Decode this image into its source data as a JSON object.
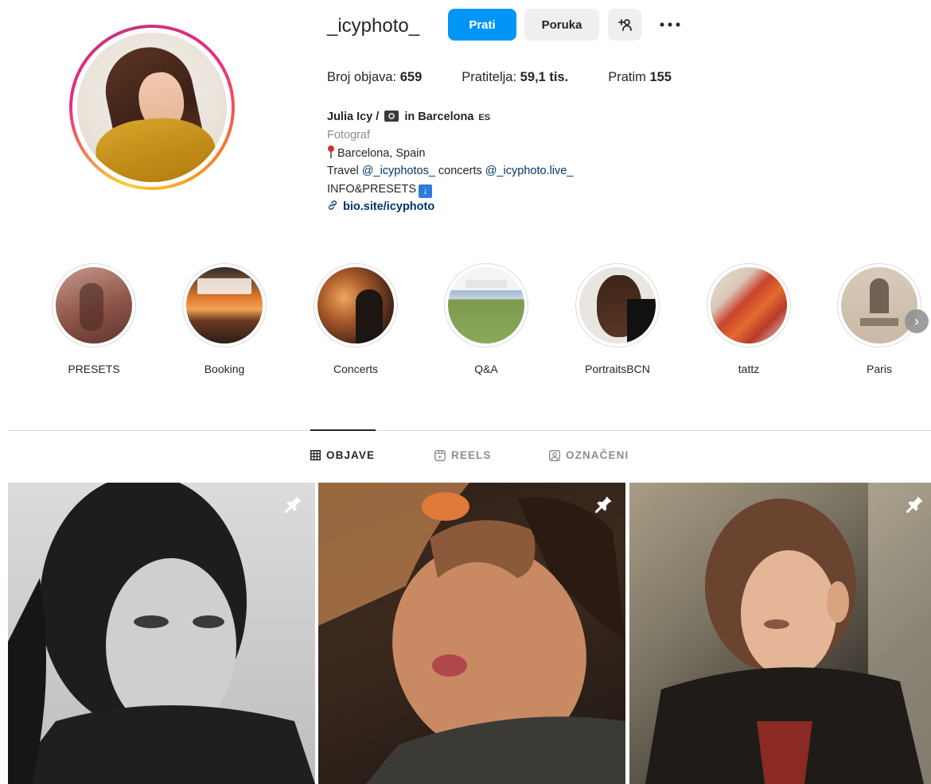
{
  "profile": {
    "username": "_icyphoto_",
    "buttons": {
      "follow": "Prati",
      "message": "Poruka",
      "add_user_icon": "person-add-icon",
      "more_icon": "more-horizontal-icon"
    },
    "stats": {
      "posts_label": "Broj objava:",
      "posts_value": "659",
      "followers_label": "Pratitelja:",
      "followers_value": "59,1 tis.",
      "following_label": "Pratim",
      "following_value": "155"
    },
    "bio": {
      "name_prefix": "Julia Icy /",
      "name_suffix": "in Barcelona",
      "name_flag": "ES",
      "category": "Fotograf",
      "location": "Barcelona, Spain",
      "travel_prefix": "Travel",
      "travel_mention": "@_icyphotos_",
      "concerts_text": "concerts",
      "concerts_mention": "@_icyphoto.live_",
      "info": "INFO&PRESETS",
      "link": "bio.site/icyphoto"
    }
  },
  "highlights": [
    {
      "label": "PRESETS"
    },
    {
      "label": "Booking"
    },
    {
      "label": "Concerts"
    },
    {
      "label": "Q&A"
    },
    {
      "label": "PortraitsBCN"
    },
    {
      "label": "tattz"
    },
    {
      "label": "Paris"
    }
  ],
  "tabs": [
    {
      "label": "OBJAVE",
      "icon": "grid-icon",
      "active": true
    },
    {
      "label": "REELS",
      "icon": "reels-icon",
      "active": false
    },
    {
      "label": "OZNAČENI",
      "icon": "tagged-icon",
      "active": false
    }
  ],
  "posts": [
    {
      "pinned": true,
      "tone": "black-and-white portrait"
    },
    {
      "pinned": true,
      "tone": "warm sunlit portrait"
    },
    {
      "pinned": true,
      "tone": "backlit portrait"
    }
  ],
  "colors": {
    "accent": "#0095f6",
    "link": "#00376b",
    "secondary_text": "#8e8e8e"
  }
}
